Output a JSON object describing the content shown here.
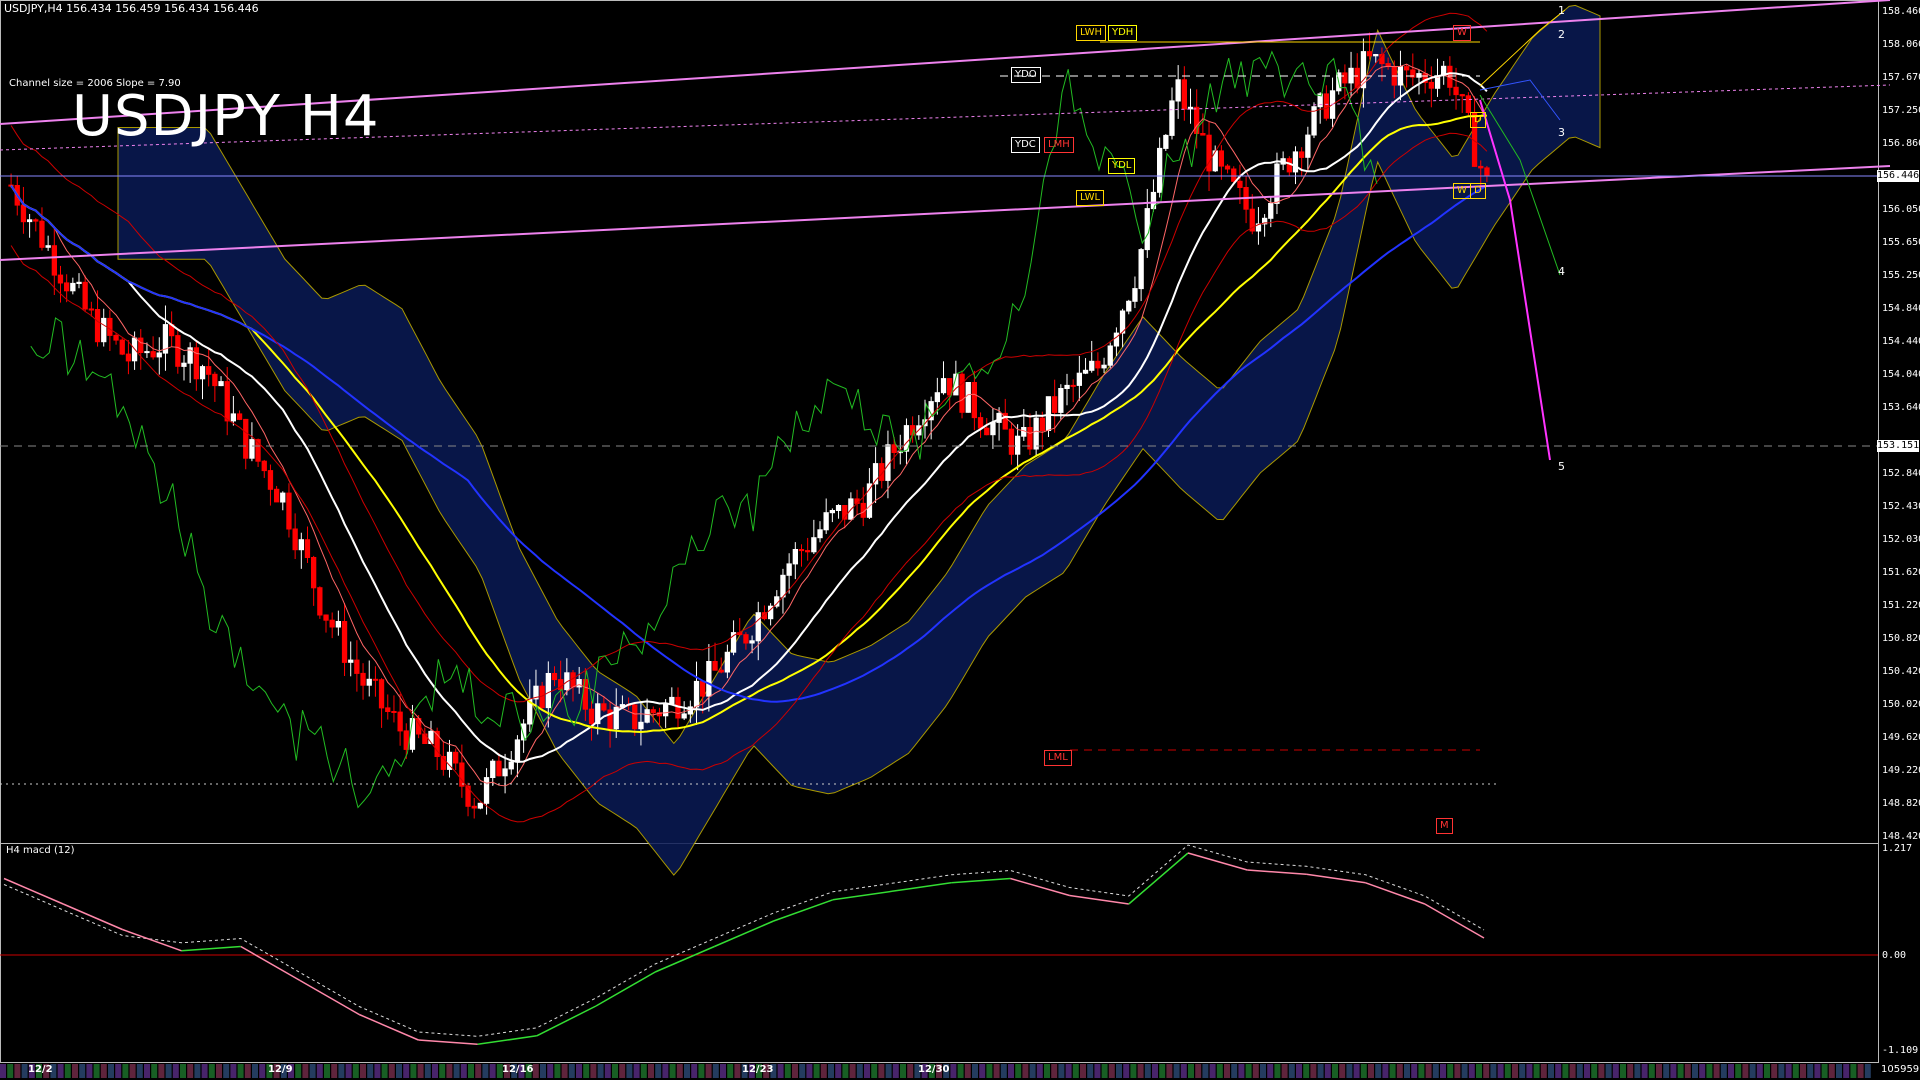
{
  "header": {
    "symbol_info": "USDJPY,H4  156.434 156.459 156.434 156.446",
    "channel_info": "Channel size = 2006 Slope = 7.90",
    "title": "USDJPY H4"
  },
  "macd": {
    "title": "H4  macd (12)",
    "axis_labels": [
      "1.217",
      "0.00",
      "-1.109"
    ]
  },
  "price_axis": {
    "ticks": [
      "158.460",
      "158.060",
      "157.670",
      "157.250",
      "156.860",
      "156.050",
      "155.650",
      "155.250",
      "154.840",
      "154.440",
      "154.040",
      "153.640",
      "152.840",
      "152.430",
      "152.030",
      "151.620",
      "151.220",
      "150.820",
      "150.420",
      "150.020",
      "149.620",
      "149.220",
      "148.820",
      "148.420"
    ],
    "current_price": "156.446",
    "marked_price": "153.151"
  },
  "date_labels": [
    "12/2",
    "12/9",
    "12/16",
    "12/23",
    "12/30"
  ],
  "volume_label": "105959",
  "level_labels": {
    "lwh": "LWH",
    "ydh": "YDH",
    "ydo": "YDO",
    "ydc": "YDC",
    "lmh": "LMH",
    "ydl": "YDL",
    "lwl": "LWL",
    "lml": "LML",
    "w": "W",
    "d": "D",
    "m": "M"
  },
  "channel_numbers": [
    "1",
    "2",
    "3",
    "4",
    "5"
  ],
  "colors": {
    "bull": "#ffffff",
    "bear": "#ff0000",
    "channel": "#ee82ee",
    "ma_white": "#ffffff",
    "ma_yellow": "#ffff00",
    "ma_blue": "#2233ff",
    "chikou": "#22bb22",
    "macd_up": "#33dd33",
    "macd_down": "#ff88aa"
  },
  "chart_data": {
    "type": "candlestick",
    "title": "USDJPY H4",
    "x": [
      "12/2",
      "12/9",
      "12/16",
      "12/23",
      "12/30"
    ],
    "close_path": [
      156.4,
      155.6,
      154.8,
      154.3,
      154.5,
      154.2,
      153.3,
      152.6,
      151.3,
      150.4,
      149.8,
      149.5,
      148.9,
      149.7,
      150.5,
      150.0,
      149.9,
      150.1,
      150.4,
      151.0,
      151.8,
      152.3,
      152.6,
      153.4,
      154.1,
      153.6,
      153.2,
      153.8,
      154.2,
      155.4,
      157.6,
      156.6,
      156.0,
      156.8,
      157.5,
      157.9,
      157.7,
      157.8,
      156.4
    ],
    "ylim": [
      148.42,
      158.6
    ],
    "current_price": 156.446,
    "series": [
      {
        "name": "macd",
        "values": [
          0.9,
          0.6,
          0.3,
          0.05,
          0.1,
          -0.3,
          -0.7,
          -1.0,
          -1.05,
          -0.95,
          -0.6,
          -0.2,
          0.1,
          0.4,
          0.65,
          0.75,
          0.85,
          0.9,
          0.7,
          0.6,
          1.2,
          1.0,
          0.95,
          0.85,
          0.6,
          0.2
        ]
      }
    ]
  }
}
